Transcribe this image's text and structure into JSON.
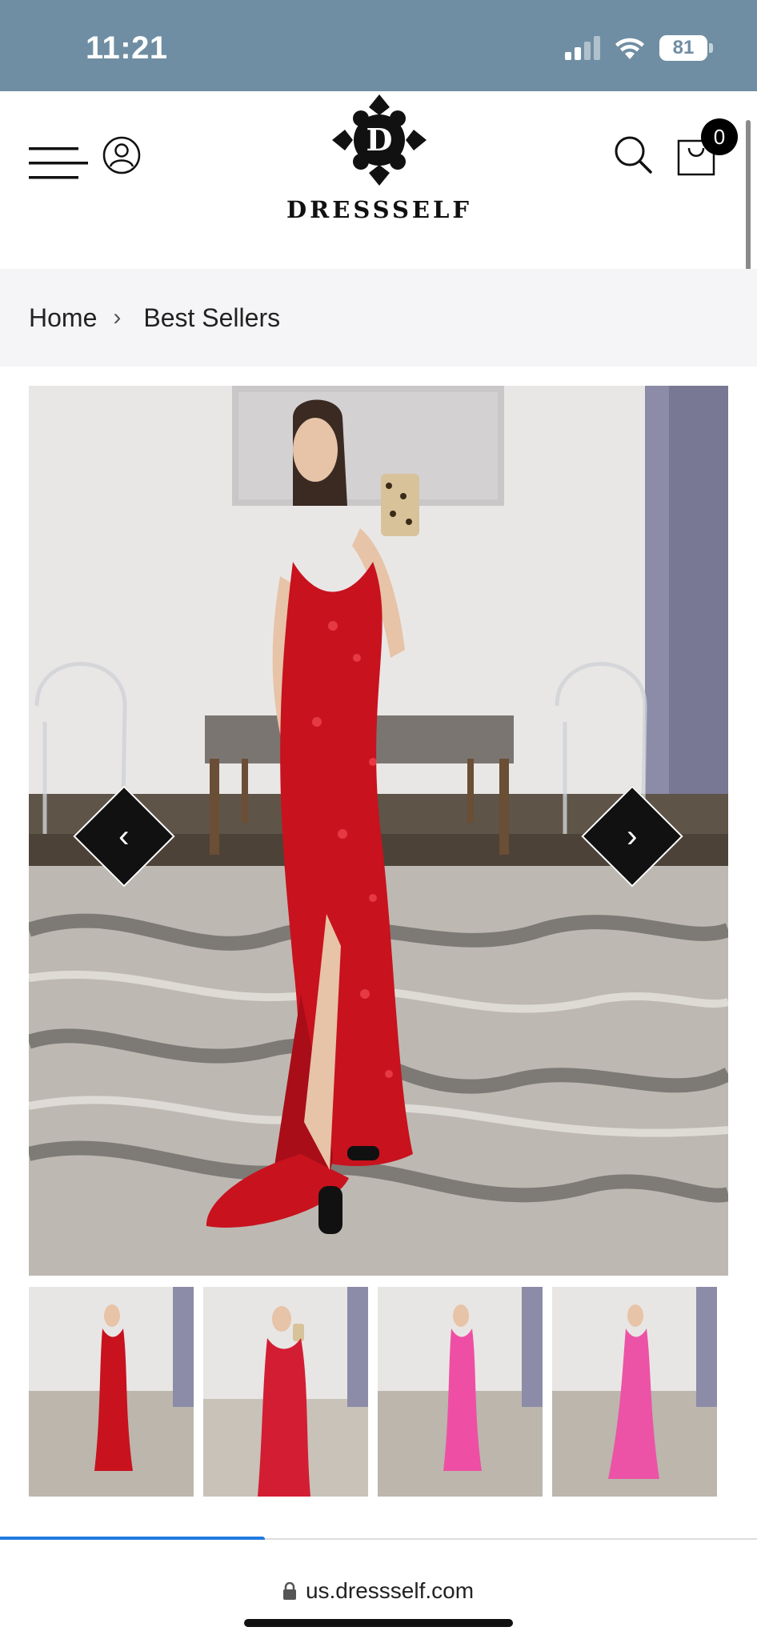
{
  "status_bar": {
    "time": "11:21",
    "battery": "81"
  },
  "header": {
    "logo_letter": "D",
    "logo_text": "DRESSSELF",
    "cart_count": "0"
  },
  "breadcrumb": {
    "items": [
      "Home",
      "Best Sellers"
    ]
  },
  "gallery": {
    "prev_glyph": "‹",
    "next_glyph": "›",
    "thumbnail_dress_colors": [
      "#c8121e",
      "#d31d33",
      "#ee4fa4",
      "#ec53a6"
    ],
    "image_progress": 0.35
  },
  "browser": {
    "url": "us.dressself.com"
  },
  "colors": {
    "status_bar": "#6f8ea3",
    "breadcrumb_bg": "#f5f5f7",
    "dress_red": "#c8121e",
    "accent_blue": "#1f7ae0"
  },
  "icons": [
    "hamburger-menu-icon",
    "account-icon",
    "search-icon",
    "cart-icon",
    "chevron-right-icon",
    "chevron-left-icon",
    "lock-icon"
  ]
}
